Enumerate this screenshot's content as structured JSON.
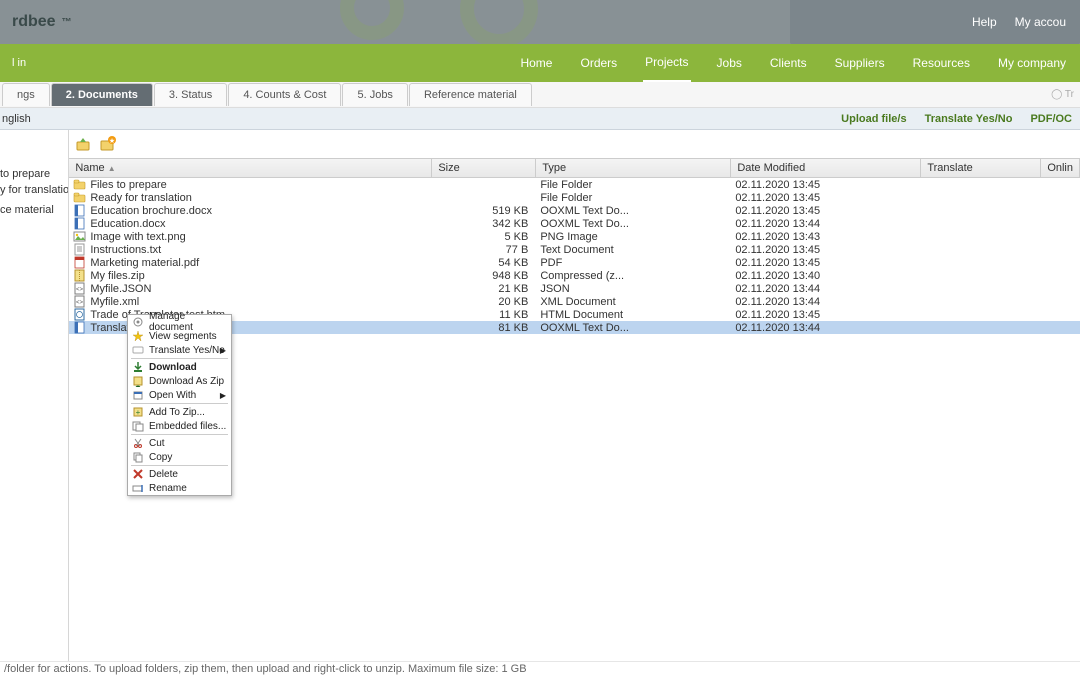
{
  "brand": "rdbee",
  "topbar": {
    "help": "Help",
    "account": "My accou"
  },
  "nav": {
    "left": "l in",
    "items": [
      "Home",
      "Orders",
      "Projects",
      "Jobs",
      "Clients",
      "Suppliers",
      "Resources",
      "My company"
    ],
    "active": "Projects"
  },
  "tabs": {
    "items": [
      "ngs",
      "2.  Documents",
      "3.  Status",
      "4.  Counts & Cost",
      "5.  Jobs",
      "Reference material"
    ],
    "active_index": 1,
    "right": "◯ Tr"
  },
  "subheader": {
    "left": "nglish",
    "actions": [
      "Upload file/s",
      "Translate Yes/No",
      "PDF/OC"
    ]
  },
  "sidebar": {
    "items": [
      "to prepare",
      "y for translation",
      "",
      "ce material"
    ]
  },
  "columns": [
    "Name",
    "Size",
    "Type",
    "Date Modified",
    "Translate",
    "Onlin"
  ],
  "files": [
    {
      "icon": "folder",
      "name": "Files to prepare",
      "size": "",
      "type": "File Folder",
      "date": "02.11.2020 13:45"
    },
    {
      "icon": "folder",
      "name": "Ready for translation",
      "size": "",
      "type": "File Folder",
      "date": "02.11.2020 13:45"
    },
    {
      "icon": "docx",
      "name": "Education brochure.docx",
      "size": "519 KB",
      "type": "OOXML Text Do...",
      "date": "02.11.2020 13:45"
    },
    {
      "icon": "docx",
      "name": "Education.docx",
      "size": "342 KB",
      "type": "OOXML Text Do...",
      "date": "02.11.2020 13:44"
    },
    {
      "icon": "png",
      "name": "Image with text.png",
      "size": "5 KB",
      "type": "PNG Image",
      "date": "02.11.2020 13:43"
    },
    {
      "icon": "txt",
      "name": "Instructions.txt",
      "size": "77 B",
      "type": "Text Document",
      "date": "02.11.2020 13:45"
    },
    {
      "icon": "pdf",
      "name": "Marketing material.pdf",
      "size": "54 KB",
      "type": "PDF",
      "date": "02.11.2020 13:45"
    },
    {
      "icon": "zip",
      "name": "My files.zip",
      "size": "948 KB",
      "type": "Compressed (z...",
      "date": "02.11.2020 13:40"
    },
    {
      "icon": "json",
      "name": "Myfile.JSON",
      "size": "21 KB",
      "type": "JSON",
      "date": "02.11.2020 13:44"
    },
    {
      "icon": "xml",
      "name": "Myfile.xml",
      "size": "20 KB",
      "type": "XML Document",
      "date": "02.11.2020 13:44"
    },
    {
      "icon": "html",
      "name": "Trade of Translator test.htm",
      "size": "11 KB",
      "type": "HTML Document",
      "date": "02.11.2020 13:45"
    },
    {
      "icon": "docx",
      "name": "Translation.docx",
      "size": "81 KB",
      "type": "OOXML Text Do...",
      "date": "02.11.2020 13:44",
      "selected": true
    }
  ],
  "context_menu": {
    "groups": [
      [
        "Manage document",
        "View segments",
        "Translate Yes/No>"
      ],
      [
        "Download*",
        "Download As Zip",
        "Open With>"
      ],
      [
        "Add To Zip...",
        "Embedded files..."
      ],
      [
        "Cut",
        "Copy"
      ],
      [
        "Delete",
        "Rename"
      ]
    ]
  },
  "footer": "/folder for actions. To upload folders, zip them, then upload and right-click to unzip. Maximum file size: 1 GB"
}
